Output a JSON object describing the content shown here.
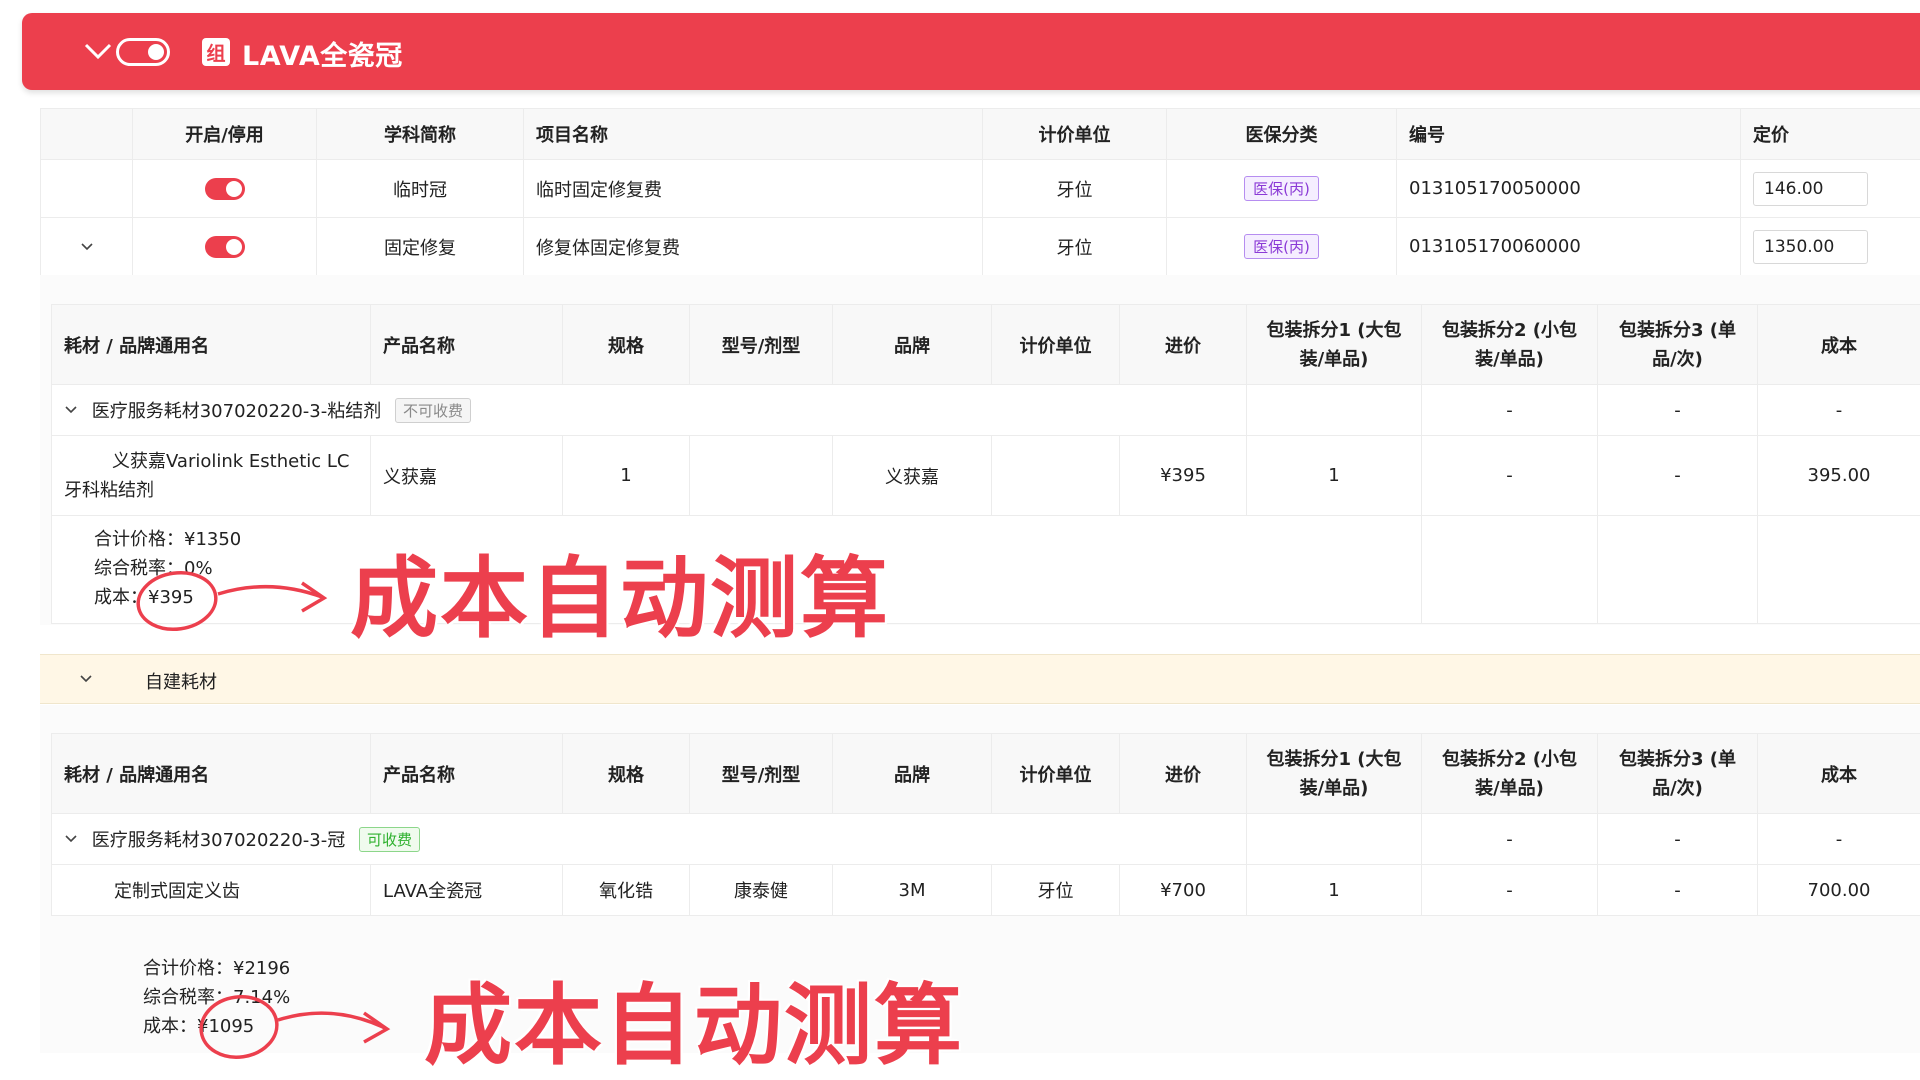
{
  "header": {
    "badge": "组",
    "title": "LAVA全瓷冠",
    "accent": "#ec3f4d"
  },
  "items_table": {
    "headers": [
      "开启/停用",
      "学科简称",
      "项目名称",
      "计价单位",
      "医保分类",
      "编号",
      "定价"
    ],
    "rows": [
      {
        "subject": "临时冠",
        "name": "临时固定修复费",
        "unit": "牙位",
        "insurance": "医保(丙)",
        "code": "013105170050000",
        "price": "146.00",
        "enabled": true
      },
      {
        "subject": "固定修复",
        "name": "修复体固定修复费",
        "unit": "牙位",
        "insurance": "医保(丙)",
        "code": "013105170060000",
        "price": "1350.00",
        "enabled": true
      }
    ]
  },
  "materials_table_1": {
    "headers": [
      "耗材 / 品牌通用名",
      "产品名称",
      "规格",
      "型号/剂型",
      "品牌",
      "计价单位",
      "进价",
      "包装拆分1 (大包装/单品)",
      "包装拆分2 (小包装/单品)",
      "包装拆分3 (单品/次)",
      "成本"
    ],
    "group": {
      "name": "医疗服务耗材307020220-3-粘结剂",
      "tag": "不可收费",
      "split2": "-",
      "split3": "-",
      "cost": "-"
    },
    "row": {
      "material": "义获嘉Variolink Esthetic LC牙科粘结剂",
      "product": "义获嘉",
      "spec": "1",
      "model": "",
      "brand": "义获嘉",
      "unit": "",
      "price": "¥395",
      "split1": "1",
      "split2": "-",
      "split3": "-",
      "cost": "395.00"
    },
    "summary": {
      "total": "合计价格：¥1350",
      "tax": "综合税率：0%",
      "cost": "成本：¥395"
    }
  },
  "self_built": {
    "label": "自建耗材"
  },
  "materials_table_2": {
    "headers": [
      "耗材 / 品牌通用名",
      "产品名称",
      "规格",
      "型号/剂型",
      "品牌",
      "计价单位",
      "进价",
      "包装拆分1 (大包装/单品)",
      "包装拆分2 (小包装/单品)",
      "包装拆分3 (单品/次)",
      "成本"
    ],
    "group": {
      "name": "医疗服务耗材307020220-3-冠",
      "tag": "可收费",
      "split2": "-",
      "split3": "-",
      "cost": "-"
    },
    "row": {
      "material": "定制式固定义齿",
      "product": "LAVA全瓷冠",
      "spec": "氧化锆",
      "model": "康泰健",
      "brand": "3M",
      "unit": "牙位",
      "price": "¥700",
      "split1": "1",
      "split2": "-",
      "split3": "-",
      "cost": "700.00"
    },
    "summary": {
      "total": "合计价格：¥2196",
      "tax": "综合税率：7.14%",
      "cost": "成本：¥1095"
    }
  },
  "annotations": {
    "text_1": "成本自动测算",
    "text_2": "成本自动测算",
    "color": "#ec3f4d"
  }
}
